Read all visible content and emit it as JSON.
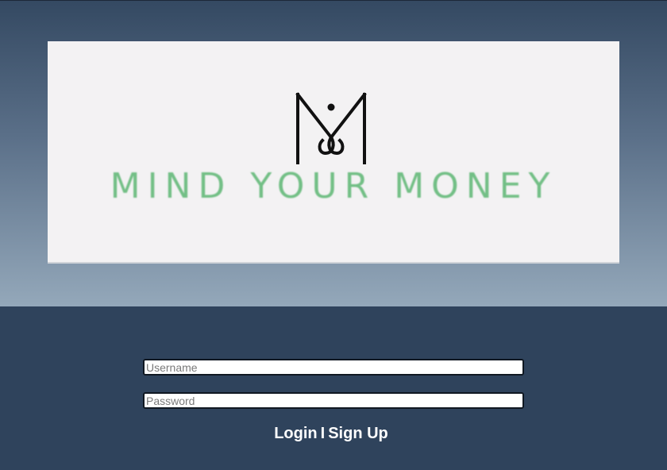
{
  "logo": {
    "wordmark": "MIND YOUR MONEY",
    "icon": "mym-monogram-icon",
    "wordmark_color": "#73bf86",
    "mark_color": "#111111"
  },
  "login": {
    "username_placeholder": "Username",
    "password_placeholder": "Password",
    "login_label": "Login",
    "separator": "I",
    "signup_label": "Sign Up"
  },
  "colors": {
    "background": "#2f435c",
    "card": "#f3f2f3"
  }
}
